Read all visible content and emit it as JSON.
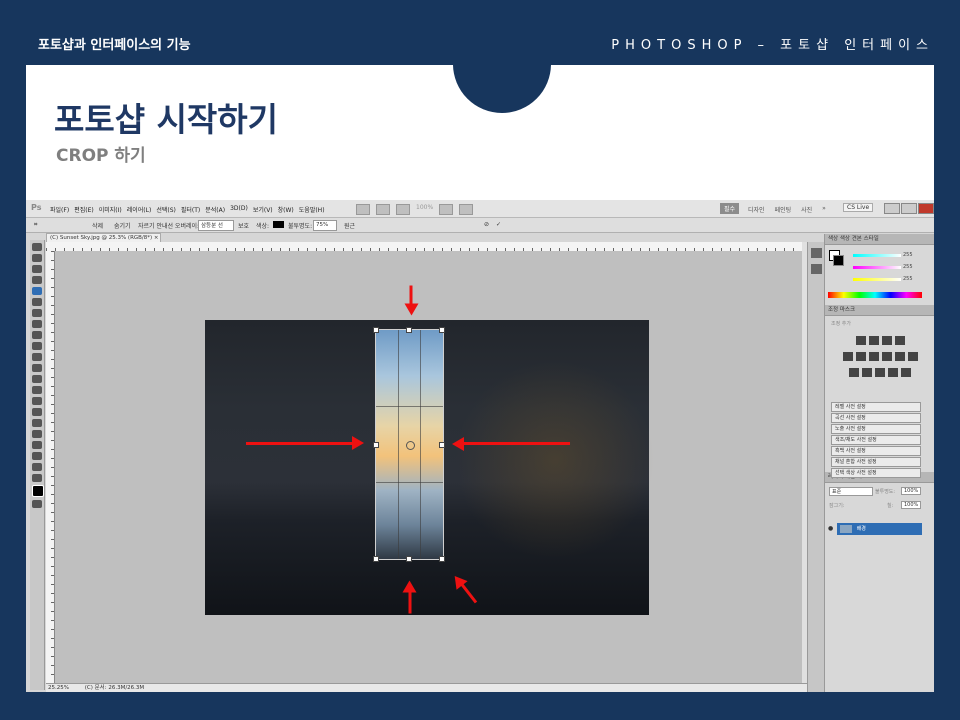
{
  "slide": {
    "top_left": "포토샵과 인터페이스의 기능",
    "top_right": "PHOTOSHOP – 포토샵 인터페이스",
    "title": "포토샵 시작하기",
    "subtitle": "CROP 하기"
  },
  "photoshop": {
    "logo": "Ps",
    "menu": [
      "파일(F)",
      "편집(E)",
      "이미지(I)",
      "레이어(L)",
      "선택(S)",
      "필터(T)",
      "분석(A)",
      "3D(D)",
      "보기(V)",
      "창(W)",
      "도움말(H)"
    ],
    "zoom_menubar": "100%",
    "workspace_active": "필수",
    "workspaces": [
      "디자인",
      "페인팅",
      "사진"
    ],
    "more": "»",
    "cs_live": "CS Live",
    "options": {
      "delete": "삭제",
      "hide": "숨기기",
      "guide_label": "자르기 안내선 오버레이:",
      "guide_value": "삼등분 선",
      "shield_label": "보호",
      "color_label": "색상:",
      "opacity_label": "불투명도:",
      "opacity_value": "75%",
      "perspective": "원근"
    },
    "doc_tab": "(C) Sunset Sky.jpg @ 25.3% (RGB/8*) ×",
    "status_zoom": "25.25%",
    "status_doc": "(C) 문서: 26.3M/26.3M",
    "color_panel": {
      "tabs": "색상 색상 견본 스타일",
      "values": [
        "255",
        "255",
        "255"
      ]
    },
    "adjust_panel": {
      "tabs": "조정 마스크",
      "hint": "조정 추가",
      "presets": [
        "레벨 사전 설정",
        "곡선 사전 설정",
        "노출 사전 설정",
        "색조/채도 사전 설정",
        "흑백 사전 설정",
        "채널 혼합 사전 설정",
        "선택 색상 사전 설정"
      ]
    },
    "layers_panel": {
      "tabs": "레이어 채널 패스",
      "blend": "표준",
      "opacity_label": "불투명도:",
      "opacity": "100%",
      "lock_label": "잠그기:",
      "fill_label": "칠:",
      "fill": "100%",
      "layer_name": "배경"
    }
  }
}
